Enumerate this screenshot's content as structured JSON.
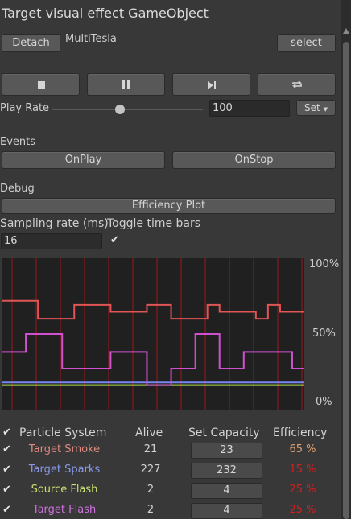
{
  "window": {
    "title": "Target visual effect GameObject"
  },
  "header": {
    "detach_label": "Detach",
    "target_name": "MultiTesla",
    "select_label": "select"
  },
  "playback": {
    "icons": [
      "stop-icon",
      "pause-icon",
      "step-icon",
      "restart-icon"
    ],
    "play_rate_label": "Play Rate",
    "play_rate_value": "100",
    "slider_value_fraction": 0.45,
    "set_label": "Set"
  },
  "events": {
    "label": "Events",
    "on_play": "OnPlay",
    "on_stop": "OnStop"
  },
  "debug": {
    "label": "Debug",
    "mode_button": "Efficiency Plot",
    "sampling_label": "Sampling rate (ms)",
    "sampling_value": "16",
    "toggle_label": "Toggle time bars",
    "toggle_checked": true
  },
  "chart_data": {
    "type": "line",
    "y_tick_labels": [
      "100%",
      "50%",
      "0%"
    ],
    "ylim": [
      0,
      100
    ],
    "grid": "vertical red lines",
    "series": [
      {
        "name": "Target Smoke",
        "color": "#e05555",
        "x": [
          0,
          1,
          2,
          3,
          4,
          5,
          6,
          7,
          8,
          9,
          10,
          11,
          12,
          13,
          14,
          15,
          16,
          17,
          18,
          19,
          20,
          21,
          22,
          23,
          24,
          25
        ],
        "values": [
          74,
          74,
          74,
          61,
          61,
          61,
          71,
          71,
          71,
          66,
          66,
          66,
          71,
          71,
          61,
          61,
          61,
          71,
          66,
          66,
          66,
          61,
          71,
          66,
          66,
          71
        ]
      },
      {
        "name": "Target Sparks",
        "color": "#7a86f0",
        "x": [
          0,
          1,
          2,
          3,
          4,
          5,
          6,
          7,
          8,
          9,
          10,
          11,
          12,
          13,
          14,
          15,
          16,
          17,
          18,
          19,
          20,
          21,
          22,
          23,
          24,
          25
        ],
        "values": [
          15,
          15,
          15,
          15,
          15,
          15,
          15,
          15,
          15,
          15,
          15,
          15,
          15,
          15,
          15,
          15,
          15,
          15,
          15,
          15,
          15,
          15,
          15,
          15,
          15,
          15
        ]
      },
      {
        "name": "Source Flash",
        "color": "#b0e050",
        "x": [
          0,
          1,
          2,
          3,
          4,
          5,
          6,
          7,
          8,
          9,
          10,
          11,
          12,
          13,
          14,
          15,
          16,
          17,
          18,
          19,
          20,
          21,
          22,
          23,
          24,
          25
        ],
        "values": [
          13,
          13,
          13,
          13,
          13,
          13,
          13,
          13,
          13,
          13,
          13,
          13,
          13,
          13,
          13,
          13,
          13,
          13,
          13,
          13,
          13,
          13,
          13,
          13,
          13,
          13
        ]
      },
      {
        "name": "Target Flash",
        "color": "#d050d0",
        "x": [
          0,
          1,
          2,
          3,
          4,
          5,
          6,
          7,
          8,
          9,
          10,
          11,
          12,
          13,
          14,
          15,
          16,
          17,
          18,
          19,
          20,
          21,
          22,
          23,
          24,
          25
        ],
        "values": [
          37,
          37,
          50,
          50,
          50,
          25,
          25,
          25,
          25,
          37,
          37,
          37,
          13,
          13,
          25,
          25,
          50,
          50,
          25,
          25,
          37,
          37,
          37,
          37,
          25,
          25
        ]
      }
    ]
  },
  "table": {
    "headers": {
      "system": "Particle System",
      "alive": "Alive",
      "capacity": "Set Capacity",
      "efficiency": "Efficiency"
    },
    "rows": [
      {
        "name": "Target Smoke",
        "alive": "21",
        "capacity": "23",
        "efficiency": "65 %",
        "name_color": "#e08a80",
        "eff_color": "#e0a070"
      },
      {
        "name": "Target Sparks",
        "alive": "227",
        "capacity": "232",
        "efficiency": "15 %",
        "name_color": "#8898e8",
        "eff_color": "#d02020"
      },
      {
        "name": "Source Flash",
        "alive": "2",
        "capacity": "4",
        "efficiency": "25 %",
        "name_color": "#c8e070",
        "eff_color": "#d02020"
      },
      {
        "name": "Target Flash",
        "alive": "2",
        "capacity": "4",
        "efficiency": "25 %",
        "name_color": "#d070e0",
        "eff_color": "#d02020"
      }
    ]
  }
}
